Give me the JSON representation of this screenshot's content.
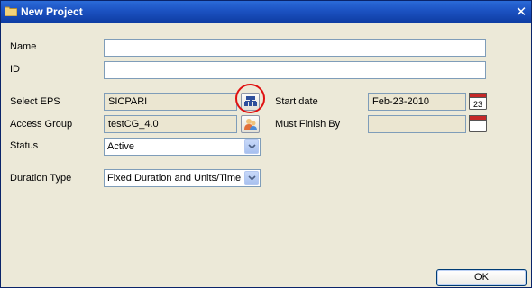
{
  "window": {
    "title": "New Project",
    "close_glyph": "✕"
  },
  "form": {
    "name": {
      "label": "Name",
      "value": ""
    },
    "id": {
      "label": "ID",
      "value": ""
    },
    "eps": {
      "label": "Select EPS",
      "value": "SICPARI",
      "button_icon": "eps-picker-icon"
    },
    "access_group": {
      "label": "Access Group",
      "value": "testCG_4.0",
      "button_icon": "group-picker-icon"
    },
    "status": {
      "label": "Status",
      "value": "Active"
    },
    "duration_type": {
      "label": "Duration Type",
      "value": "Fixed Duration and Units/Time"
    },
    "start_date": {
      "label": "Start date",
      "value": "Feb-23-2010",
      "calendar_day": "23"
    },
    "must_finish_by": {
      "label": "Must Finish By",
      "value": ""
    }
  },
  "buttons": {
    "ok": "OK"
  },
  "colors": {
    "titlebar": "#0f3da3",
    "highlight_ring": "#e01010",
    "calendar_red": "#c62828"
  }
}
